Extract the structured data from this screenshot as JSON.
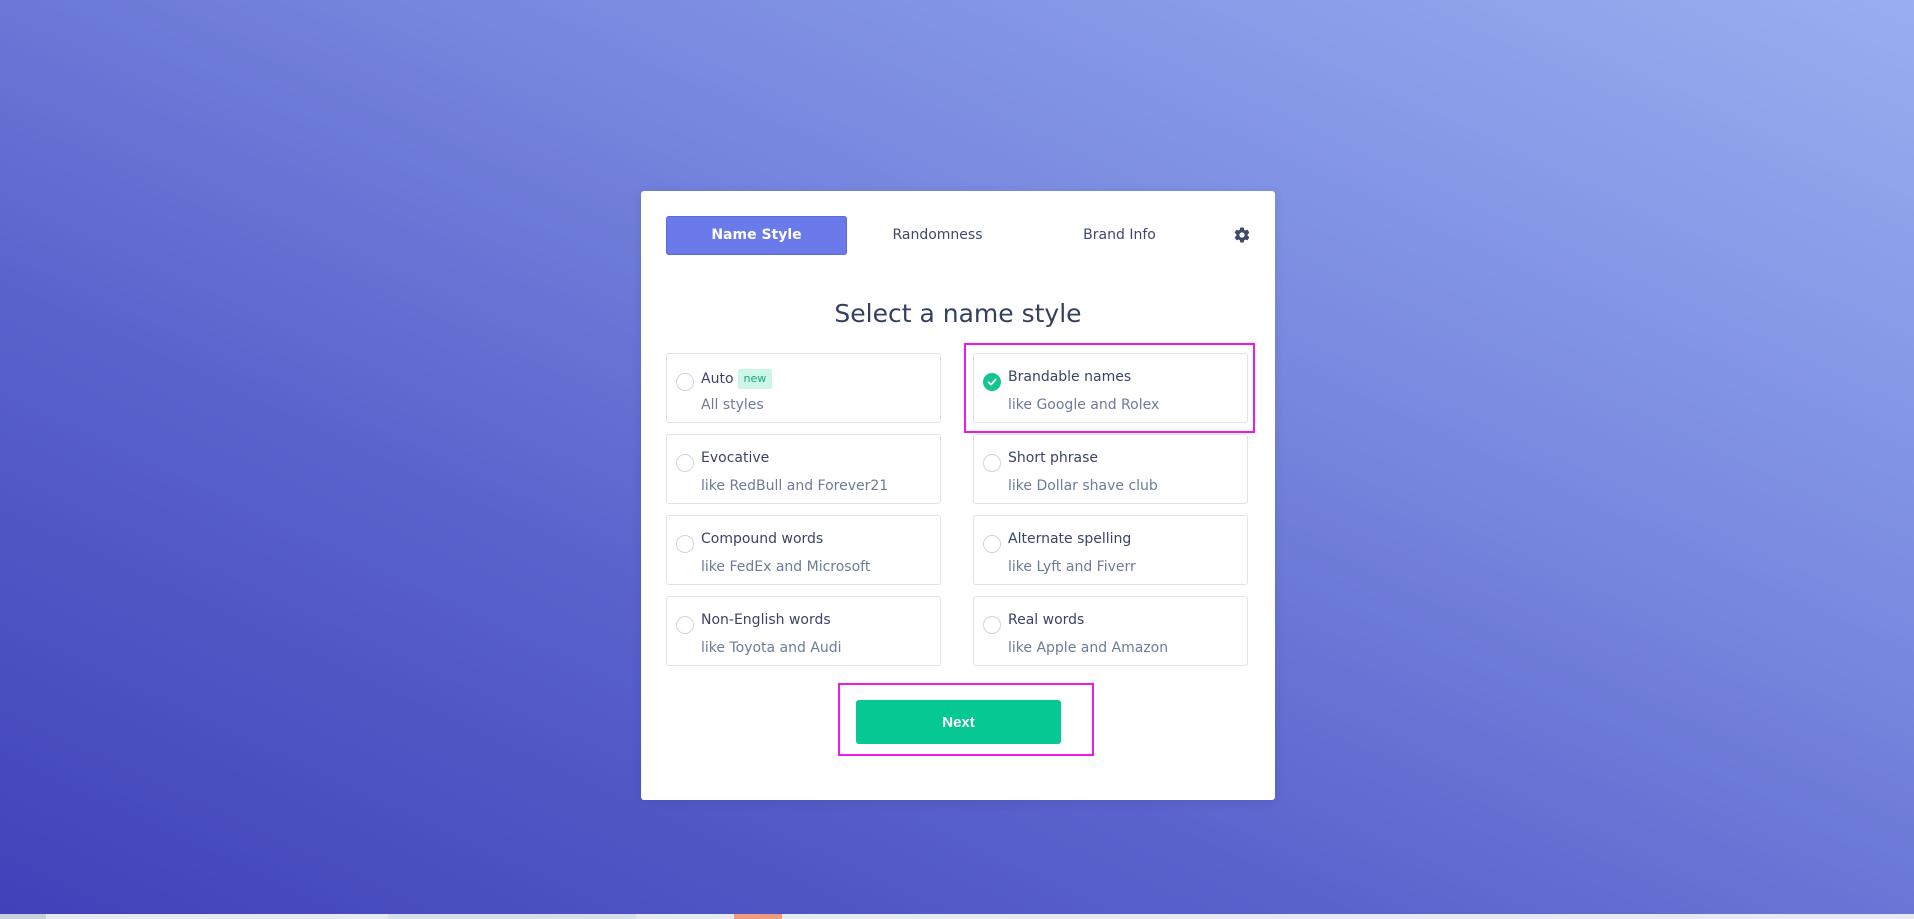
{
  "tabs": [
    {
      "label": "Name Style",
      "active": true
    },
    {
      "label": "Randomness",
      "active": false
    },
    {
      "label": "Brand Info",
      "active": false
    }
  ],
  "settings_icon": "gear-icon",
  "heading": "Select a name style",
  "options": [
    {
      "title": "Auto",
      "badge": "new",
      "subtitle": "All styles",
      "selected": false
    },
    {
      "title": "Brandable names",
      "subtitle": "like Google and Rolex",
      "selected": true
    },
    {
      "title": "Evocative",
      "subtitle": "like RedBull and Forever21",
      "selected": false
    },
    {
      "title": "Short phrase",
      "subtitle": "like Dollar shave club",
      "selected": false
    },
    {
      "title": "Compound words",
      "subtitle": "like FedEx and Microsoft",
      "selected": false
    },
    {
      "title": "Alternate spelling",
      "subtitle": "like Lyft and Fiverr",
      "selected": false
    },
    {
      "title": "Non-English words",
      "subtitle": "like Toyota and Audi",
      "selected": false
    },
    {
      "title": "Real words",
      "subtitle": "like Apple and Amazon",
      "selected": false
    }
  ],
  "next_label": "Next",
  "colors": {
    "accent": "#6a7aea",
    "success": "#05c892",
    "highlight": "#ef19e8"
  }
}
